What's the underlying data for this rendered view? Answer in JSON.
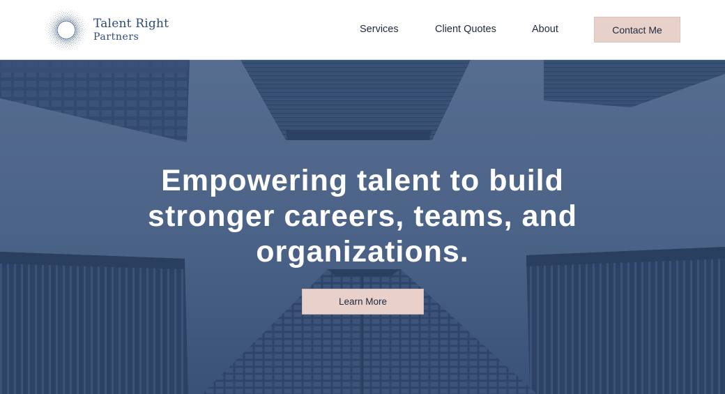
{
  "brand": {
    "name_line1": "Talent Right",
    "name_line2": "Partners"
  },
  "nav": {
    "services": "Services",
    "client_quotes": "Client Quotes",
    "about": "About",
    "contact": "Contact Me"
  },
  "hero": {
    "headline": "Empowering talent to build stronger careers, teams, and organizations.",
    "cta": "Learn More"
  },
  "colors": {
    "brand_navy": "#2d4a7a",
    "hero_overlay": "#3e5578",
    "button_blush": "#e8d1ca",
    "text_dark": "#1d2940"
  }
}
